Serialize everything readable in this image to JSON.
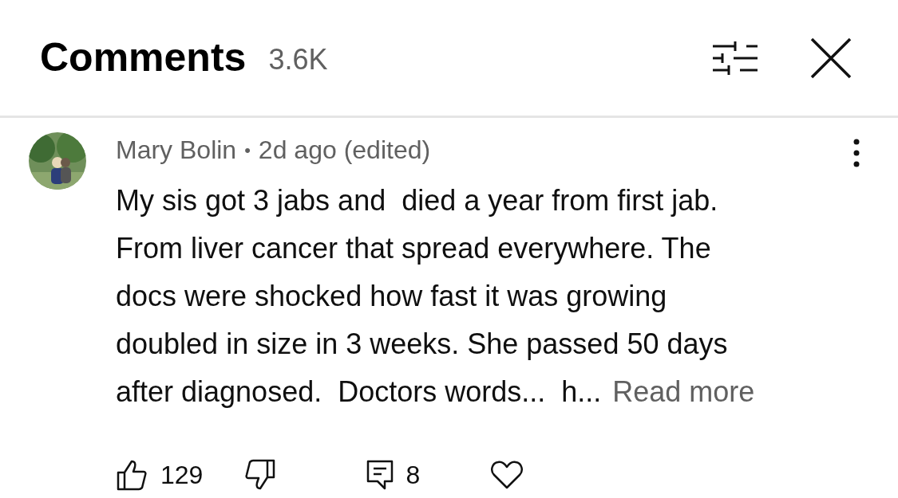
{
  "header": {
    "title": "Comments",
    "count": "3.6K"
  },
  "comment": {
    "author": "Mary Bolin",
    "separator": "•",
    "time": "2d ago (edited)",
    "lines": [
      "My sis got 3 jabs and  died a year from first jab.",
      "From liver cancer that spread everywhere. The",
      "docs were shocked how fast it was growing",
      "doubled in size in 3 weeks. She passed 50 days",
      "after diagnosed.  Doctors words...  h..."
    ],
    "read_more": "Read more",
    "likes": "129",
    "replies": "8"
  }
}
